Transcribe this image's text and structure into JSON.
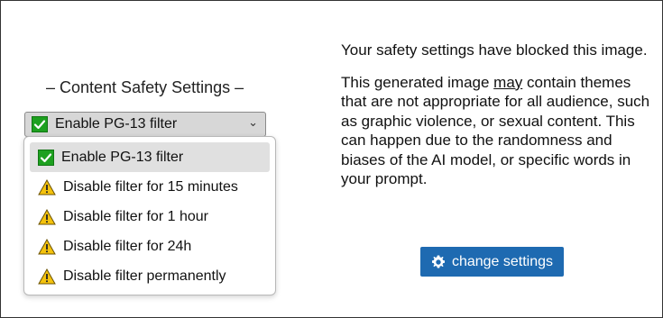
{
  "settings": {
    "title": "– Content Safety Settings –",
    "selected_label": "Enable PG-13 filter",
    "options": [
      {
        "label": "Enable PG-13 filter",
        "icon": "check-icon"
      },
      {
        "label": "Disable filter for 15 minutes",
        "icon": "warning-icon"
      },
      {
        "label": "Disable filter for 1 hour",
        "icon": "warning-icon"
      },
      {
        "label": "Disable filter for 24h",
        "icon": "warning-icon"
      },
      {
        "label": "Disable filter permanently",
        "icon": "warning-icon"
      }
    ]
  },
  "message": {
    "line1": "Your safety settings have blocked this image.",
    "p2_before": "This generated image ",
    "p2_emph": "may",
    "p2_after": " contain themes that are not appropriate for all audience, such as graphic violence, or sexual content. This can happen due to the randomness and biases of the AI model, or specific words in your prompt."
  },
  "button": {
    "label": "change settings",
    "icon": "gear-icon"
  },
  "colors": {
    "button_bg": "#1e6ab1",
    "check_green": "#1da01f",
    "warning_yellow": "#f4c20d"
  }
}
